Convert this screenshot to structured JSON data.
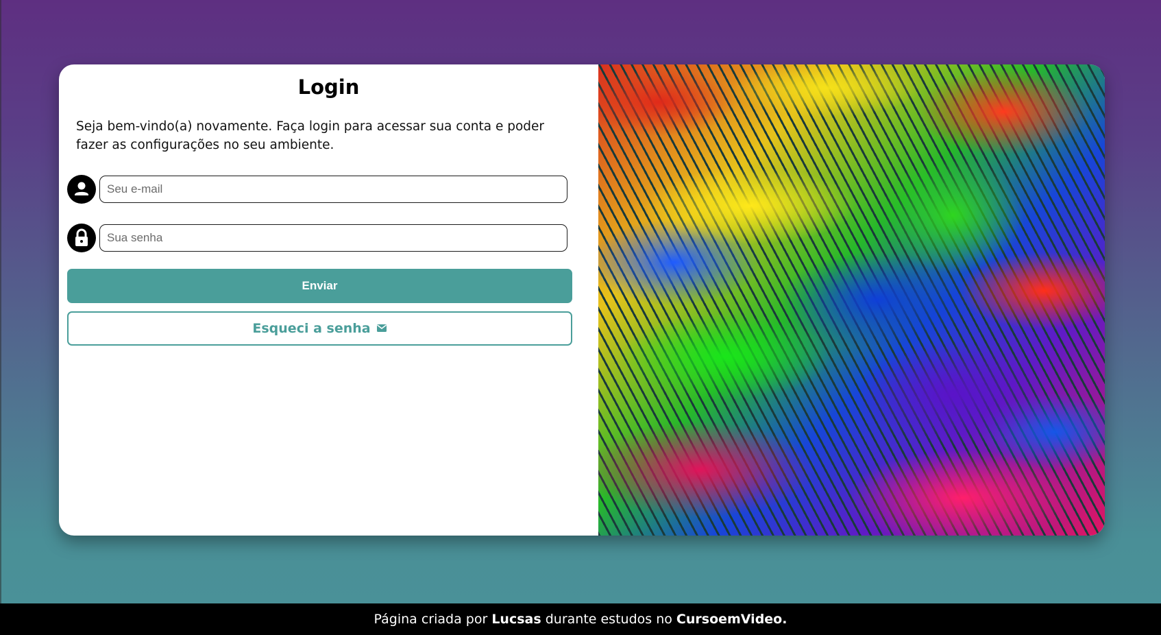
{
  "login": {
    "title": "Login",
    "intro": "Seja bem-vindo(a) novamente. Faça login para acessar sua conta e poder fazer as configurações no seu ambiente.",
    "email_placeholder": "Seu e-mail",
    "password_placeholder": "Sua senha",
    "send_label": "Enviar",
    "forgot_label": "Esqueci a senha",
    "icons": {
      "email": "person-icon",
      "password": "lock-icon",
      "forgot": "mail-icon"
    }
  },
  "footer": {
    "prefix": "Página criada por",
    "author": "Lucsas",
    "middle": "durante estudos no",
    "course": "CursoemVideo."
  },
  "colors": {
    "accent": "#4a9e9a",
    "footer_bg": "#000000",
    "gradient_top": "#5e2f81",
    "gradient_bottom": "#4a9298"
  }
}
